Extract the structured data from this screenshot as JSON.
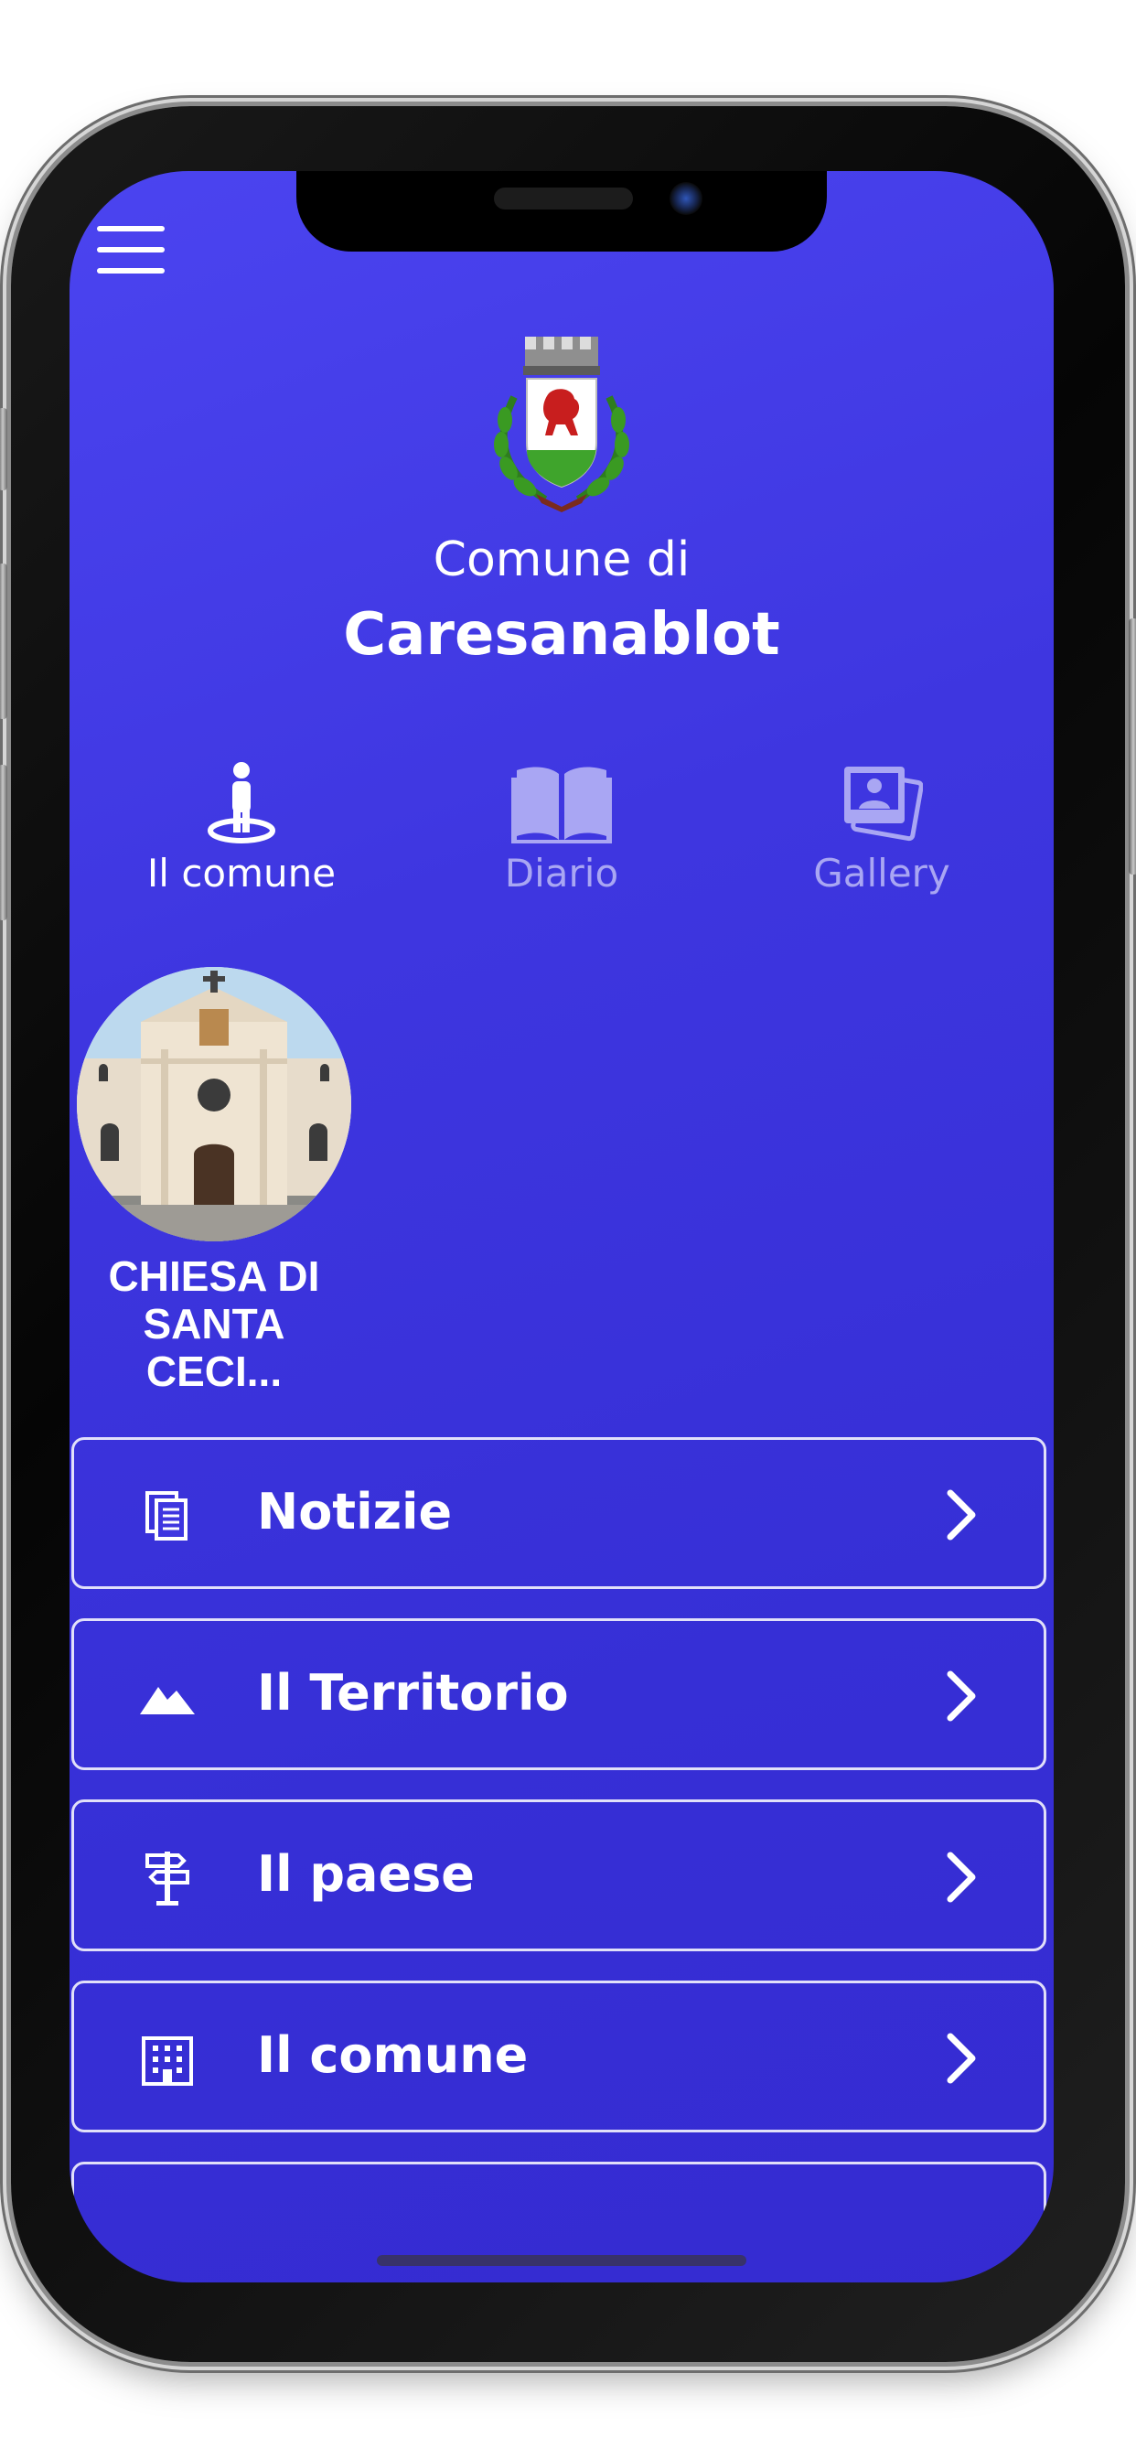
{
  "header": {
    "menu_icon": "hamburger-menu-icon",
    "crest_icon": "municipal-coat-of-arms",
    "comune_di": "Comune di",
    "city_name": "Caresanablot"
  },
  "tabs": [
    {
      "label": "Il comune",
      "icon": "person-standing-icon",
      "active": true
    },
    {
      "label": "Diario",
      "icon": "open-book-icon",
      "active": false
    },
    {
      "label": "Gallery",
      "icon": "photo-gallery-icon",
      "active": false
    }
  ],
  "featured": {
    "title_line1": "CHIESA DI",
    "title_line2": "SANTA CECI..."
  },
  "menu_items": [
    {
      "label": "Notizie",
      "icon": "documents-icon"
    },
    {
      "label": "Il Territorio",
      "icon": "mountains-icon"
    },
    {
      "label": "Il paese",
      "icon": "signpost-icon"
    },
    {
      "label": "Il comune",
      "icon": "building-icon"
    }
  ],
  "colors": {
    "background": "#3e36e0",
    "text": "#ffffff",
    "inactive_tab": "#a9a6f3"
  }
}
